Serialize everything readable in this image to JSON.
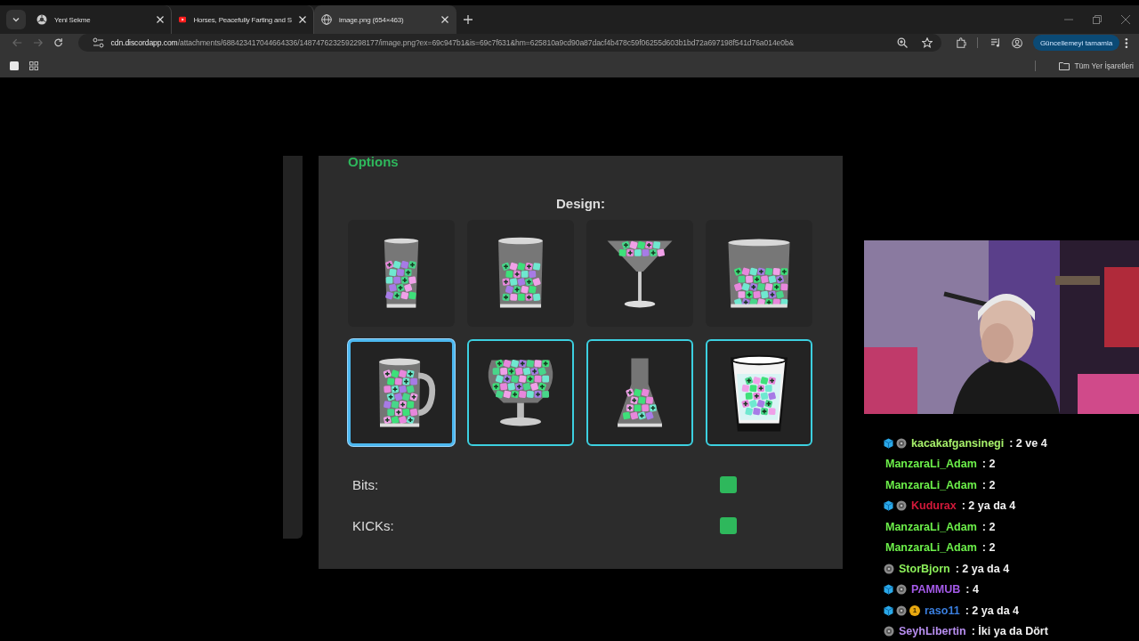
{
  "browser": {
    "tabs": [
      {
        "title": "Yeni Sekme",
        "kind": "chrome",
        "selected": false
      },
      {
        "title": "Horses, Peacefully Farting and S",
        "kind": "video",
        "selected": false
      },
      {
        "title": "image.png (654×463)",
        "kind": "globe",
        "selected": true
      }
    ],
    "address": "cdn.discordapp.com/attachments/688423417044664336/1487476232592298177/image.png?ex=69c947b1&is=69c7f631&hm=625810a9cd90a87dacf4b478c59f06255d603b1bd72a697198f541d76a014e0b&",
    "update_button": "Güncellemeyi tamamla",
    "bookmarks_label": "Tüm Yer İşaretleri"
  },
  "options": {
    "heading": "Options",
    "design_label": "Design:",
    "designs": [
      {
        "kind": "glass",
        "selected": false,
        "highlighted": false
      },
      {
        "kind": "jar",
        "selected": false,
        "highlighted": false
      },
      {
        "kind": "martini",
        "selected": false,
        "highlighted": false
      },
      {
        "kind": "tumbler",
        "selected": false,
        "highlighted": false
      },
      {
        "kind": "mug",
        "selected": true,
        "highlighted": true
      },
      {
        "kind": "snifter",
        "selected": false,
        "highlighted": true
      },
      {
        "kind": "flask",
        "selected": false,
        "highlighted": true
      },
      {
        "kind": "cup",
        "selected": false,
        "highlighted": true
      }
    ],
    "toggles": [
      {
        "label": "Bits:",
        "checked": true
      },
      {
        "label": "KICKs:",
        "checked": true
      }
    ]
  },
  "chat": [
    {
      "badges": [
        {
          "kind": "cube"
        },
        {
          "kind": "emblem"
        }
      ],
      "user": "kacakafgansinegi",
      "color": "#a6f06a",
      "text": ": 2 ve 4"
    },
    {
      "user": "ManzaraLi_Adam",
      "color": "#6cf04a",
      "text": ": 2"
    },
    {
      "user": "ManzaraLi_Adam",
      "color": "#6cf04a",
      "text": ": 2"
    },
    {
      "badges": [
        {
          "kind": "cube"
        },
        {
          "kind": "emblem"
        }
      ],
      "user": "Kudurax",
      "color": "#d2193a",
      "text": ": 2 ya da 4"
    },
    {
      "user": "ManzaraLi_Adam",
      "color": "#6cf04a",
      "text": ": 2"
    },
    {
      "user": "ManzaraLi_Adam",
      "color": "#6cf04a",
      "text": ": 2"
    },
    {
      "badges": [
        {
          "kind": "emblem"
        }
      ],
      "user": "StorBjorn",
      "color": "#8cf05a",
      "text": ": 2 ya da 4"
    },
    {
      "badges": [
        {
          "kind": "cube"
        },
        {
          "kind": "emblem"
        }
      ],
      "user": "PAMMUB",
      "color": "#a45ae8",
      "text": ": 4"
    },
    {
      "badges": [
        {
          "kind": "cube"
        },
        {
          "kind": "emblem"
        },
        {
          "kind": "coin",
          "label": "1"
        }
      ],
      "user": "raso11",
      "color": "#3a7fe0",
      "text": ": 2 ya da 4"
    },
    {
      "badges": [
        {
          "kind": "emblem"
        }
      ],
      "user": "SeyhLibertin",
      "color": "#b88ef0",
      "text": ": İki ya da Dört"
    }
  ]
}
